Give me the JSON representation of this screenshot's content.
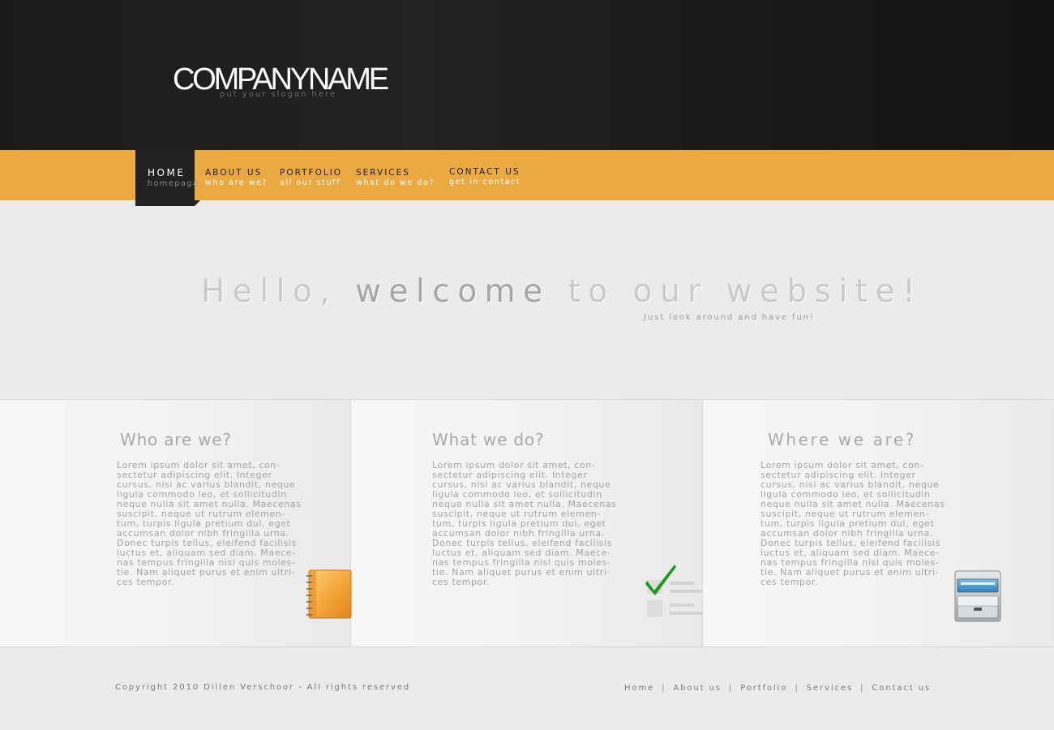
{
  "header": {
    "logo": "COMPANYNAME",
    "slogan": "put your slogan here"
  },
  "nav": {
    "items": [
      {
        "label": "HOME",
        "sub": "homepage",
        "active": true
      },
      {
        "label": "ABOUT US",
        "sub": "who are we?"
      },
      {
        "label": "PORTFOLIO",
        "sub": "all our stuff"
      },
      {
        "label": "SERVICES",
        "sub": "what do we do?"
      },
      {
        "label": "CONTACT US",
        "sub": "get in contact"
      }
    ]
  },
  "hero": {
    "title_part1": "Hello, ",
    "title_strong": "welcome",
    "title_part2": " to our website!",
    "subtitle": "Just look around and have fun!"
  },
  "features": [
    {
      "title": "Who are we?",
      "text": "Lorem ipsum dolor sit amet, con-sectetur adipiscing elit. Integer cursus, nisi ac varius blandit, neque ligula commodo leo, et sollicitudin neque nulla sit amet nulla. Maecenas suscipit, neque ut rutrum elemen-tum, turpis ligula pretium dui, eget accumsan dolor nibh fringilla urna. Donec turpis tellus, eleifend facilisis luctus et, aliquam sed diam. Maece-nas tempus fringilla nisl quis moles-tie. Nam aliquet purus et enim ultri-ces tempor.",
      "icon": "notebook-icon"
    },
    {
      "title": "What we do?",
      "text": "Lorem ipsum dolor sit amet, con-sectetur adipiscing elit. Integer cursus, nisi ac varius blandit, neque ligula commodo leo, et sollicitudin neque nulla sit amet nulla. Maecenas suscipit, neque ut rutrum elemen-tum, turpis ligula pretium dui, eget accumsan dolor nibh fringilla urna. Donec turpis tellus, eleifend facilisis luctus et, aliquam sed diam. Maece-nas tempus fringilla nisl quis moles-tie. Nam aliquet purus et enim ultri-ces tempor.",
      "icon": "checklist-icon"
    },
    {
      "title": "Where we are?",
      "text": "Lorem ipsum dolor sit amet, con-sectetur adipiscing elit. Integer cursus, nisi ac varius blandit, neque ligula commodo leo, et sollicitudin neque nulla sit amet nulla. Maecenas suscipit, neque ut rutrum elemen-tum, turpis ligula pretium dui, eget accumsan dolor nibh fringilla urna. Donec turpis tellus, eleifend facilisis luctus et, aliquam sed diam. Maece-nas tempus fringilla nisl quis moles-tie. Nam aliquet purus et enim ultri-ces tempor.",
      "icon": "file-cabinet-icon"
    }
  ],
  "footer": {
    "copyright": "Copyright 2010 Dillen Verschoor - All rights reserved",
    "links": [
      "Home",
      "About us",
      "Portfolio",
      "Services",
      "Contact us"
    ],
    "separator": "|"
  },
  "colors": {
    "header_bg": "#1b1b1b",
    "nav_accent": "#eba942",
    "nav_active_bg": "#222222",
    "page_bg": "#ebebeb",
    "checkmark": "#1f9a1f"
  }
}
